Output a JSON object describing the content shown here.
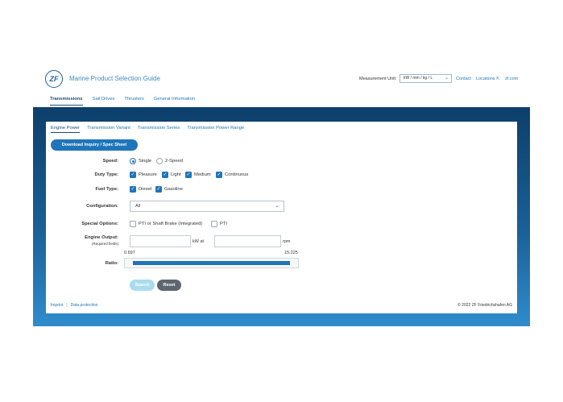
{
  "header": {
    "logo_text": "ZF",
    "app_title": "Marine Product Selection Guide",
    "measurement_label": "Measurement Unit:",
    "measurement_value": "kW / mm / kg / L",
    "links": {
      "contact": "Contact",
      "locations": "Locations",
      "zf": "zf.com"
    }
  },
  "main_tabs": [
    {
      "label": "Transmissions",
      "active": true
    },
    {
      "label": "Sail Drives",
      "active": false
    },
    {
      "label": "Thrusters",
      "active": false
    },
    {
      "label": "General Information",
      "active": false
    }
  ],
  "sub_tabs": [
    {
      "label": "Engine Power",
      "active": true
    },
    {
      "label": "Transmission Variant",
      "active": false
    },
    {
      "label": "Transmission Series",
      "active": false
    },
    {
      "label": "Transmission Power Range",
      "active": false
    }
  ],
  "download_button": "Download Inquiry / Spec Sheet",
  "form": {
    "speed": {
      "label": "Speed:",
      "options": [
        "Single",
        "2-Speed"
      ],
      "selected": "Single"
    },
    "duty_type": {
      "label": "Duty Type:",
      "options": [
        "Pleasure",
        "Light",
        "Medium",
        "Continuous"
      ],
      "checked": [
        true,
        true,
        true,
        true
      ]
    },
    "fuel_type": {
      "label": "Fuel Type:",
      "options": [
        "Diesel",
        "Gasoline"
      ],
      "checked": [
        true,
        true
      ]
    },
    "configuration": {
      "label": "Configuration:",
      "value": "All"
    },
    "special_options": {
      "label": "Special Options:",
      "options": [
        "PTI or Shaft Brake (Integrated)",
        "PTI"
      ],
      "checked": [
        false,
        false
      ]
    },
    "engine_output": {
      "label": "Engine Output:",
      "sublabel": "(Required fields)",
      "unit_power": "kW at",
      "unit_speed": "rpm",
      "power_value": "",
      "speed_value": ""
    },
    "ratio": {
      "label": "Ratio:",
      "min": "0.697",
      "max": "15.225",
      "min_value": 0.697,
      "max_value": 15.225
    }
  },
  "buttons": {
    "search": "Search",
    "reset": "Reset"
  },
  "footer": {
    "imprint": "Imprint",
    "separator": "|",
    "data_protection": "Data protection",
    "copyright": "© 2022 ZF Friedrichshafen AG"
  },
  "colors": {
    "accent": "#1f75b9",
    "band_dark": "#0d3f6b",
    "band_light": "#2f8ccd",
    "reset_bg": "#5d6670",
    "search_bg": "#a9dcef"
  },
  "icons": {
    "logo": "zf-logo",
    "external_link": "external-link-icon",
    "chevron": "chevron-down-icon",
    "check": "checkmark-icon"
  }
}
